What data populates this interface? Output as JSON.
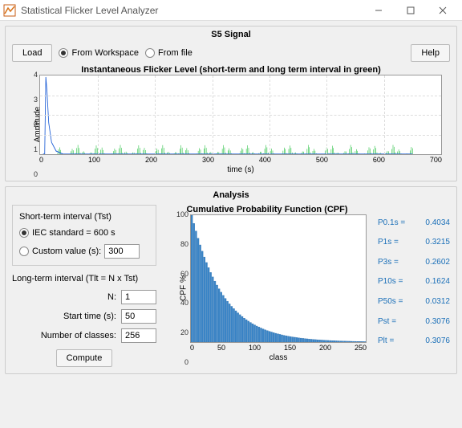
{
  "window": {
    "title": "Statistical Flicker Level Analyzer"
  },
  "s5": {
    "panel_title": "S5 Signal",
    "load_btn": "Load",
    "from_workspace": "From Workspace",
    "from_file": "From file",
    "help_btn": "Help",
    "chart_title": "Instantaneous Flicker Level (short-term and long term interval in green)",
    "ylabel": "Amplitude",
    "xlabel": "time (s)"
  },
  "analysis": {
    "panel_title": "Analysis",
    "tst_title": "Short-term interval  (Tst)",
    "iec_label": "IEC standard  = 600 s",
    "custom_label": "Custom value (s):",
    "custom_value": "300",
    "tlt_title": "Long-term interval (Tlt = N x Tst)",
    "n_label": "N:",
    "n_value": "1",
    "start_label": "Start time (s):",
    "start_value": "50",
    "classes_label": "Number of classes:",
    "classes_value": "256",
    "compute_btn": "Compute",
    "cpf_title": "Cumulative Probability Function (CPF)",
    "cpf_ylabel": "CPF %",
    "cpf_xlabel": "class",
    "stats": {
      "p01": {
        "k": "P0.1s =",
        "v": "0.4034"
      },
      "p1": {
        "k": "P1s =",
        "v": "0.3215"
      },
      "p3": {
        "k": "P3s =",
        "v": "0.2602"
      },
      "p10": {
        "k": "P10s =",
        "v": "0.1624"
      },
      "p50": {
        "k": "P50s =",
        "v": "0.0312"
      },
      "pst": {
        "k": "Pst =",
        "v": "0.3076"
      },
      "plt": {
        "k": "Plt =",
        "v": "0.3076"
      }
    }
  },
  "chart_data": [
    {
      "type": "line",
      "title": "Instantaneous Flicker Level (short-term and long term interval in green)",
      "xlabel": "time (s)",
      "ylabel": "Amplitude",
      "xlim": [
        0,
        700
      ],
      "ylim": [
        0,
        4
      ],
      "x_ticks": [
        0,
        100,
        200,
        300,
        400,
        500,
        600,
        700
      ],
      "y_ticks": [
        0,
        1,
        2,
        3,
        4
      ],
      "series": [
        {
          "name": "blue-spike",
          "color": "#1f5fd6",
          "note": "initial transient ~4 at t≈10s decaying to 0 by t≈30s"
        },
        {
          "name": "green-noise",
          "color": "#1fbf3a",
          "note": "low amplitude noise 0–0.5 across 30–650s"
        }
      ]
    },
    {
      "type": "bar",
      "title": "Cumulative Probability Function (CPF)",
      "xlabel": "class",
      "ylabel": "CPF %",
      "xlim": [
        0,
        250
      ],
      "ylim": [
        0,
        100
      ],
      "x_ticks": [
        0,
        50,
        100,
        150,
        200,
        250
      ],
      "y_ticks": [
        0,
        20,
        40,
        60,
        80,
        100
      ],
      "categories_sample": [
        0,
        10,
        20,
        30,
        40,
        50,
        60,
        70,
        80,
        100,
        120,
        150,
        180,
        210,
        240
      ],
      "values_sample": [
        100,
        60,
        42,
        32,
        25,
        20,
        15,
        12,
        10,
        7,
        5,
        3,
        1.5,
        0.8,
        0.3
      ],
      "color": "#3a84c6"
    }
  ]
}
